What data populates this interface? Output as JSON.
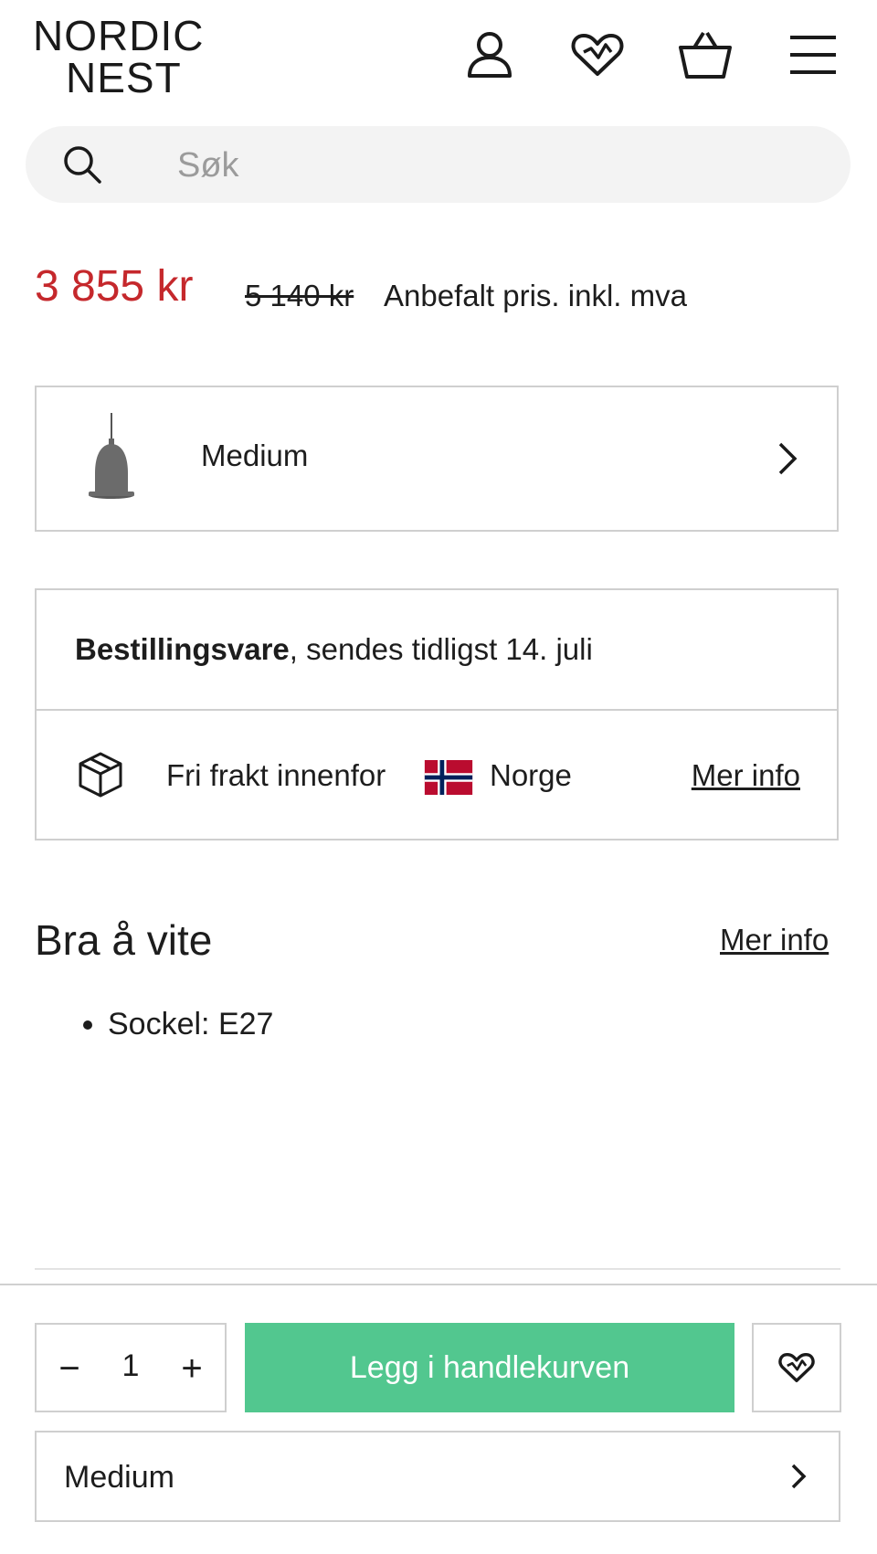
{
  "header": {
    "logo_line1": "NORDIC",
    "logo_line2": "NEST",
    "icons": [
      "user-icon",
      "heart-icon",
      "basket-icon",
      "menu-icon"
    ]
  },
  "search": {
    "placeholder": "Søk"
  },
  "pricing": {
    "price": "3 855 kr",
    "old_price": "5 140 kr",
    "note": "Anbefalt pris. inkl. mva",
    "price_color": "#c5282c"
  },
  "variant_selector": {
    "label": "Medium"
  },
  "delivery": {
    "status_bold": "Bestillingsvare",
    "status_rest": ", sendes tidligst 14. juli",
    "shipping_text": "Fri frakt innenfor",
    "country": "Norge",
    "more_info": "Mer info"
  },
  "good_to_know": {
    "title": "Bra å vite",
    "more_info": "Mer info",
    "items": [
      "Sockel: E27"
    ]
  },
  "purchase": {
    "quantity": "1",
    "minus": "−",
    "plus": "+",
    "add_to_cart": "Legg i handlekurven",
    "button_color": "#52c78f",
    "variant_label": "Medium"
  }
}
